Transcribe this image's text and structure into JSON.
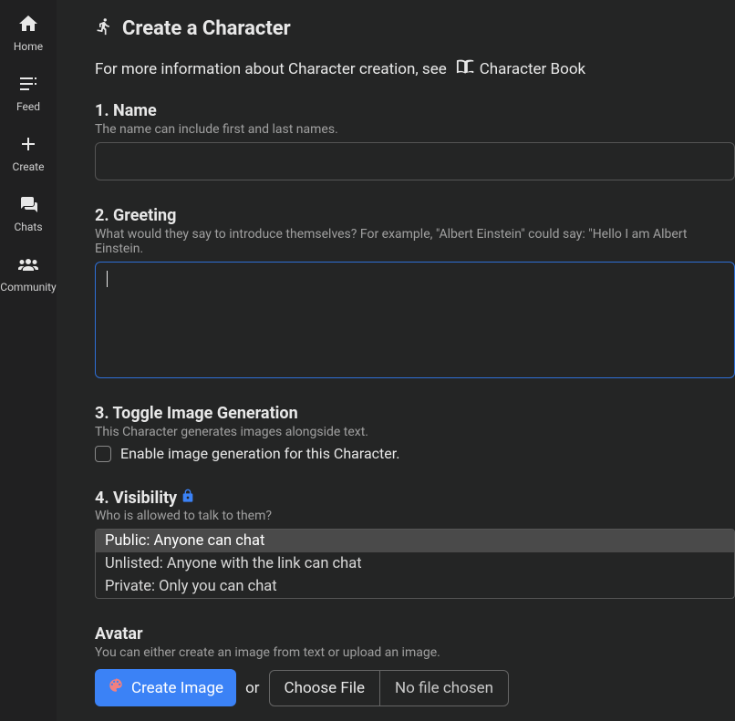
{
  "sidebar": {
    "items": [
      {
        "label": "Home"
      },
      {
        "label": "Feed"
      },
      {
        "label": "Create"
      },
      {
        "label": "Chats"
      },
      {
        "label": "Community"
      }
    ]
  },
  "page": {
    "title": "Create a Character",
    "info_prefix": "For more information about Character creation, see",
    "book_link": "Character Book"
  },
  "sections": {
    "name": {
      "head": "1. Name",
      "sub": "The name can include first and last names.",
      "value": ""
    },
    "greeting": {
      "head": "2. Greeting",
      "sub": "What would they say to introduce themselves? For example, \"Albert Einstein\" could say: \"Hello I am Albert Einstein.",
      "value": ""
    },
    "toggle": {
      "head": "3. Toggle Image Generation",
      "sub": "This Character generates images alongside text.",
      "checkbox_label": "Enable image generation for this Character."
    },
    "visibility": {
      "head": "4. Visibility",
      "sub": "Who is allowed to talk to them?",
      "options": [
        "Public: Anyone can chat",
        "Unlisted: Anyone with the link can chat",
        "Private: Only you can chat"
      ],
      "selected_index": 0
    },
    "avatar": {
      "head": "Avatar",
      "sub": "You can either create an image from text or upload an image.",
      "create_btn": "Create Image",
      "or": "or",
      "choose_btn": "Choose File",
      "file_status": "No file chosen"
    }
  }
}
